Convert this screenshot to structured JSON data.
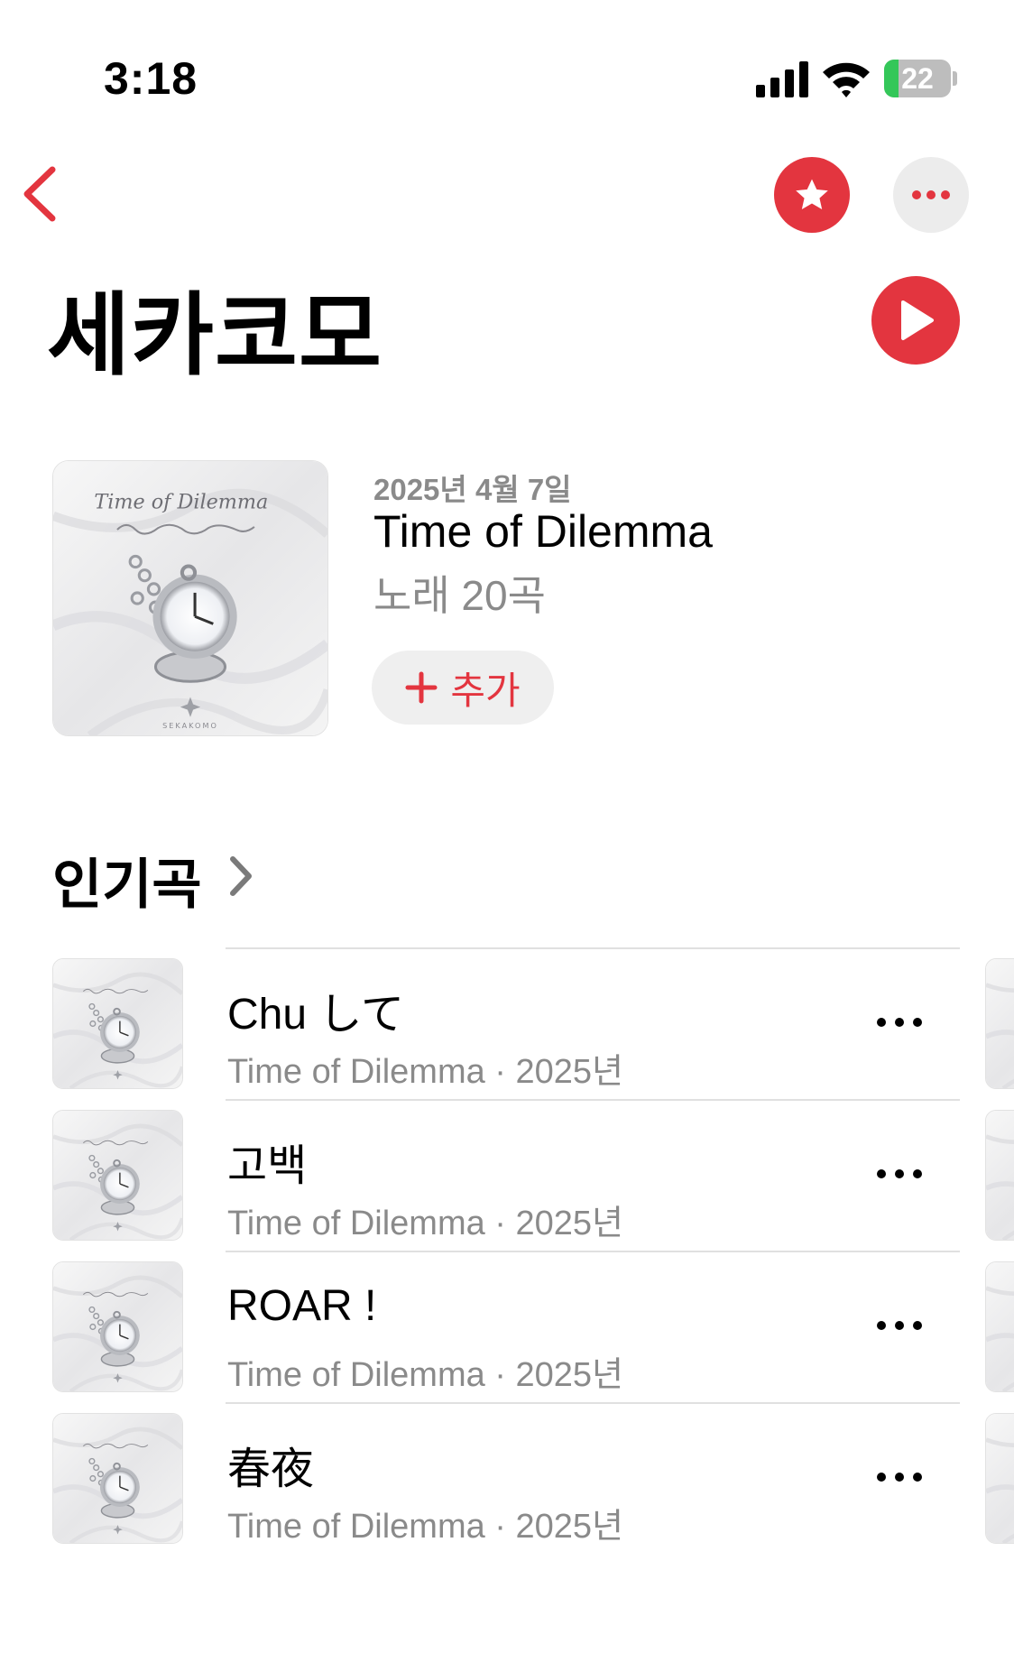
{
  "status_bar": {
    "time": "3:18",
    "battery_level": "22",
    "battery_fraction": 0.22
  },
  "nav": {
    "back_icon": "chevron-left-icon",
    "favorite_icon": "star-icon",
    "more_icon": "ellipsis-icon"
  },
  "artist": {
    "name": "세카코모"
  },
  "latest_release": {
    "date": "2025년 4월 7일",
    "title": "Time of Dilemma",
    "track_count": "노래 20곡",
    "add_label": "추가",
    "cover_text": "Time of Dilemma",
    "cover_brand": "SEKAKOMO"
  },
  "top_songs": {
    "heading": "인기곡",
    "items": [
      {
        "title": "Chu して",
        "subtitle": "Time of Dilemma · 2025년"
      },
      {
        "title": "고백",
        "subtitle": "Time of Dilemma · 2025년"
      },
      {
        "title": "ROAR !",
        "subtitle": "Time of Dilemma · 2025년"
      },
      {
        "title": "春夜",
        "subtitle": "Time of Dilemma · 2025년"
      }
    ]
  },
  "colors": {
    "accent": "#e3353f",
    "secondary_text": "#8a8a8a",
    "button_bg": "#efefef",
    "battery_green": "#34c759"
  }
}
